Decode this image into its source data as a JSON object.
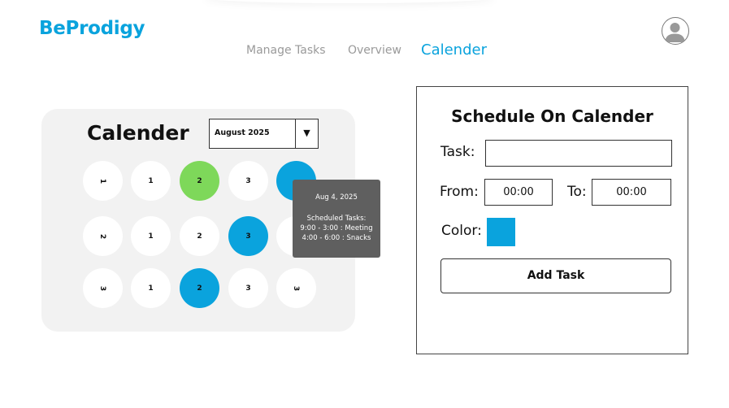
{
  "brand": {
    "logo_text": "BeProdigy",
    "color": "#0aa3dd"
  },
  "nav": {
    "tabs": [
      {
        "label": "Manage Tasks",
        "active": false
      },
      {
        "label": "Overview",
        "active": false
      },
      {
        "label": "Calender",
        "active": true
      }
    ],
    "active_color": "#0aa3dd",
    "inactive_color": "#9a9a9a"
  },
  "avatar": {
    "icon": "user-icon"
  },
  "calendar": {
    "title": "Calender",
    "month_select": {
      "value": "August 2025",
      "arrow": "▼"
    },
    "rows": [
      [
        {
          "label": "1",
          "color": "#ffffff",
          "rotated": true
        },
        {
          "label": "1",
          "color": "#ffffff",
          "rotated": false
        },
        {
          "label": "2",
          "color": "#7ed85a",
          "rotated": false
        },
        {
          "label": "3",
          "color": "#ffffff",
          "rotated": false
        },
        {
          "label": "",
          "color": "#0aa3dd",
          "rotated": false
        }
      ],
      [
        {
          "label": "2",
          "color": "#ffffff",
          "rotated": true
        },
        {
          "label": "1",
          "color": "#ffffff",
          "rotated": false
        },
        {
          "label": "2",
          "color": "#ffffff",
          "rotated": false
        },
        {
          "label": "3",
          "color": "#0aa3dd",
          "rotated": false
        },
        {
          "label": "",
          "color": "#ffffff",
          "rotated": false
        }
      ],
      [
        {
          "label": "3",
          "color": "#ffffff",
          "rotated": true
        },
        {
          "label": "1",
          "color": "#ffffff",
          "rotated": false
        },
        {
          "label": "2",
          "color": "#0aa3dd",
          "rotated": false
        },
        {
          "label": "3",
          "color": "#ffffff",
          "rotated": false
        },
        {
          "label": "3",
          "color": "#ffffff",
          "rotated": true
        }
      ]
    ],
    "tooltip": {
      "date": "Aug 4, 2025",
      "heading": "Scheduled Tasks:",
      "tasks": [
        "9:00 - 3:00 : Meeting",
        "4:00 - 6:00 : Snacks"
      ]
    }
  },
  "schedule": {
    "title": "Schedule On Calender",
    "task_label": "Task:",
    "task_value": "",
    "from_label": "From:",
    "from_value": "00:00",
    "to_label": "To:",
    "to_value": "00:00",
    "color_label": "Color:",
    "selected_color": "#0aa3dd",
    "add_button": "Add Task"
  }
}
